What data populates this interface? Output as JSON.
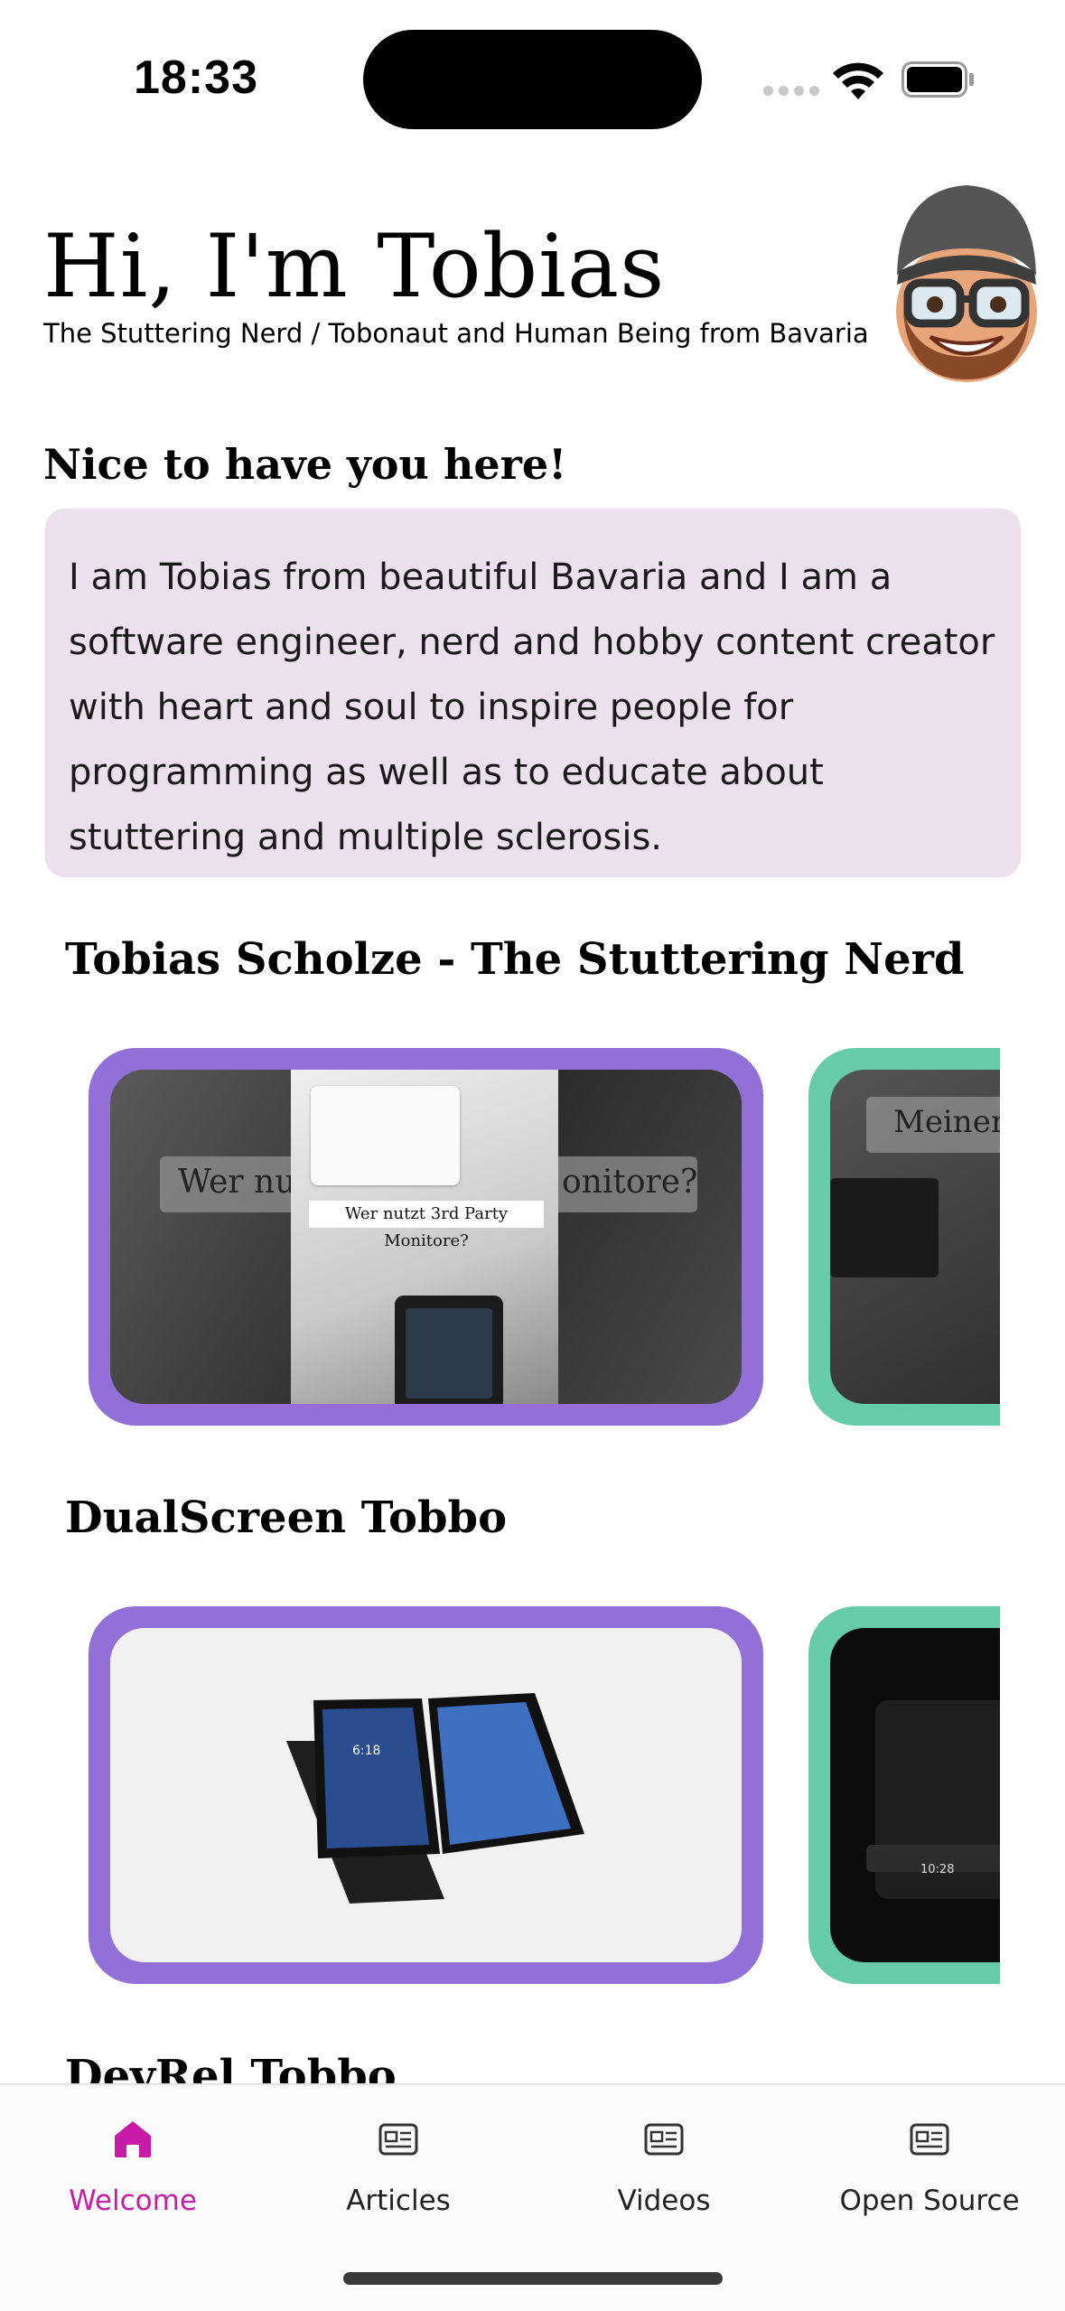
{
  "status_bar": {
    "time": "18:33"
  },
  "header": {
    "title": "Hi, I'm Tobias",
    "subtitle": "The Stuttering Nerd / Tobonaut and Human Being from Bavaria"
  },
  "intro": {
    "heading": "Nice to have you here!",
    "text": "I am Tobias from beautiful Bavaria and I am a software engineer, nerd and hobby content creator with heart and soul to inspire people for programming as well as to educate about stuttering and multiple sclerosis."
  },
  "rows": [
    {
      "title": "Tobias Scholze - The Stuttering Nerd",
      "card1_overlay_left": "Wer nu",
      "card1_overlay_right": "onitore?",
      "card1_caption": "Wer nutzt 3rd Party Monitore?",
      "card2_caption": "Meiner"
    },
    {
      "title": "DualScreen Tobbo",
      "phone_time": "6:18",
      "card2_time": "10:28"
    },
    {
      "title": "DevRel Tobbo"
    }
  ],
  "tabs": [
    {
      "label": "Welcome",
      "icon": "house-icon",
      "active": true
    },
    {
      "label": "Articles",
      "icon": "newspaper-icon",
      "active": false
    },
    {
      "label": "Videos",
      "icon": "newspaper-icon",
      "active": false
    },
    {
      "label": "Open Source",
      "icon": "newspaper-icon",
      "active": false
    }
  ],
  "colors": {
    "accent": "#c71ba8",
    "card_purple": "#9370d8",
    "card_green": "#65cba8",
    "intro_bg": "#ecdfee"
  }
}
